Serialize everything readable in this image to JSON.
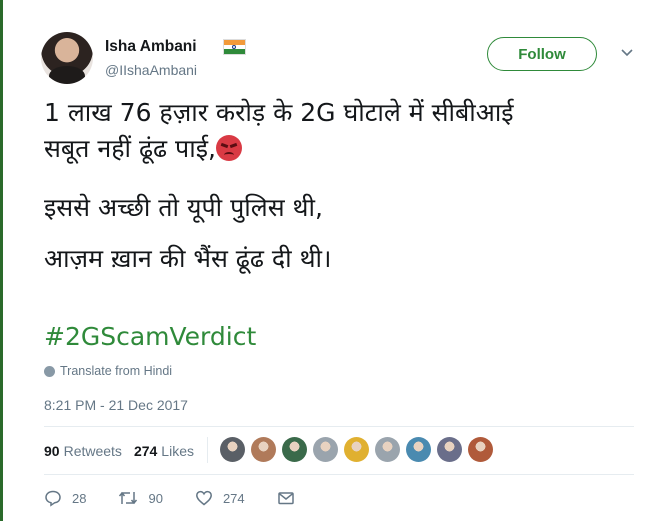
{
  "user": {
    "name": "Isha Ambani",
    "handle": "@IIshaAmbani",
    "follow_label": "Follow"
  },
  "tweet": {
    "line1": "1 लाख 76 हज़ार करोड़ के 2G घोटाले में सीबीआई",
    "line2": "सबूत नहीं ढूंढ पाई,",
    "line3": "इससे अच्छी तो यूपी पुलिस थी,",
    "line4": "आज़म ख़ान की भैंस ढूंढ दी थी।",
    "hashtag": "#2GScamVerdict",
    "translate_label": "Translate from Hindi",
    "timestamp": "8:21 PM - 21 Dec 2017"
  },
  "stats": {
    "retweets_count": "90",
    "retweets_label": "Retweets",
    "likes_count": "274",
    "likes_label": "Likes"
  },
  "actions": {
    "reply_count": "28",
    "retweet_count": "90",
    "like_count": "274"
  },
  "likers": [
    {
      "color": "#5a5f66",
      "icon": "avatar-icon"
    },
    {
      "color": "#b07a5a",
      "icon": "avatar-icon"
    },
    {
      "color": "#3a6a4a",
      "icon": "avatar-icon"
    },
    {
      "color": "#9aa4ad",
      "icon": "default-avatar-icon"
    },
    {
      "color": "#e0b030",
      "icon": "avatar-icon"
    },
    {
      "color": "#9aa4ad",
      "icon": "default-avatar-icon"
    },
    {
      "color": "#4a8ab0",
      "icon": "avatar-icon"
    },
    {
      "color": "#6a6e8a",
      "icon": "avatar-icon"
    },
    {
      "color": "#b05a3a",
      "icon": "avatar-icon"
    }
  ],
  "colors": {
    "accent": "#2f8a3a",
    "secondary_text": "#657786"
  }
}
